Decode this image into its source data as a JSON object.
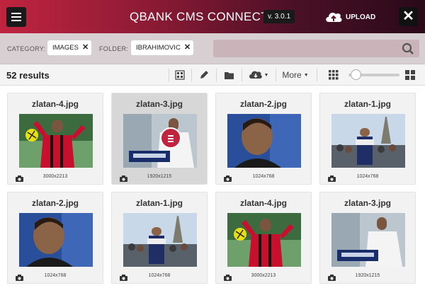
{
  "header": {
    "title": "QBANK CMS CONNECTOR",
    "version": "v. 3.0.1",
    "upload_label": "UPLOAD"
  },
  "filters": {
    "category_label": "CATEGORY:",
    "category_value": "IMAGES",
    "folder_label": "FOLDER:",
    "folder_value": "IBRAHIMOVIC",
    "search_placeholder": ""
  },
  "toolbar": {
    "results_text": "52 results",
    "more_label": "More",
    "thumbnail_size_fraction": 0.1
  },
  "images": [
    {
      "name": "zlatan-4.jpg",
      "dims": "3000x2213",
      "scene": "red-kit-ball",
      "selected": false
    },
    {
      "name": "zlatan-3.jpg",
      "dims": "1920x1215",
      "scene": "white-shirt-scarf",
      "selected": true
    },
    {
      "name": "zlatan-2.jpg",
      "dims": "1024x768",
      "scene": "portrait-blue",
      "selected": false
    },
    {
      "name": "zlatan-1.jpg",
      "dims": "1024x768",
      "scene": "eiffel-crowd",
      "selected": false
    },
    {
      "name": "zlatan-2.jpg",
      "dims": "1024x768",
      "scene": "portrait-blue",
      "selected": false
    },
    {
      "name": "zlatan-1.jpg",
      "dims": "1024x768",
      "scene": "eiffel-crowd",
      "selected": false
    },
    {
      "name": "zlatan-4.jpg",
      "dims": "3000x2213",
      "scene": "red-kit-ball",
      "selected": false
    },
    {
      "name": "zlatan-3.jpg",
      "dims": "1920x1215",
      "scene": "white-shirt-scarf",
      "selected": false
    }
  ],
  "colors": {
    "brand_red": "#c0243f",
    "header_dark": "#2a0a18",
    "filter_bg": "#d8cfd2"
  }
}
